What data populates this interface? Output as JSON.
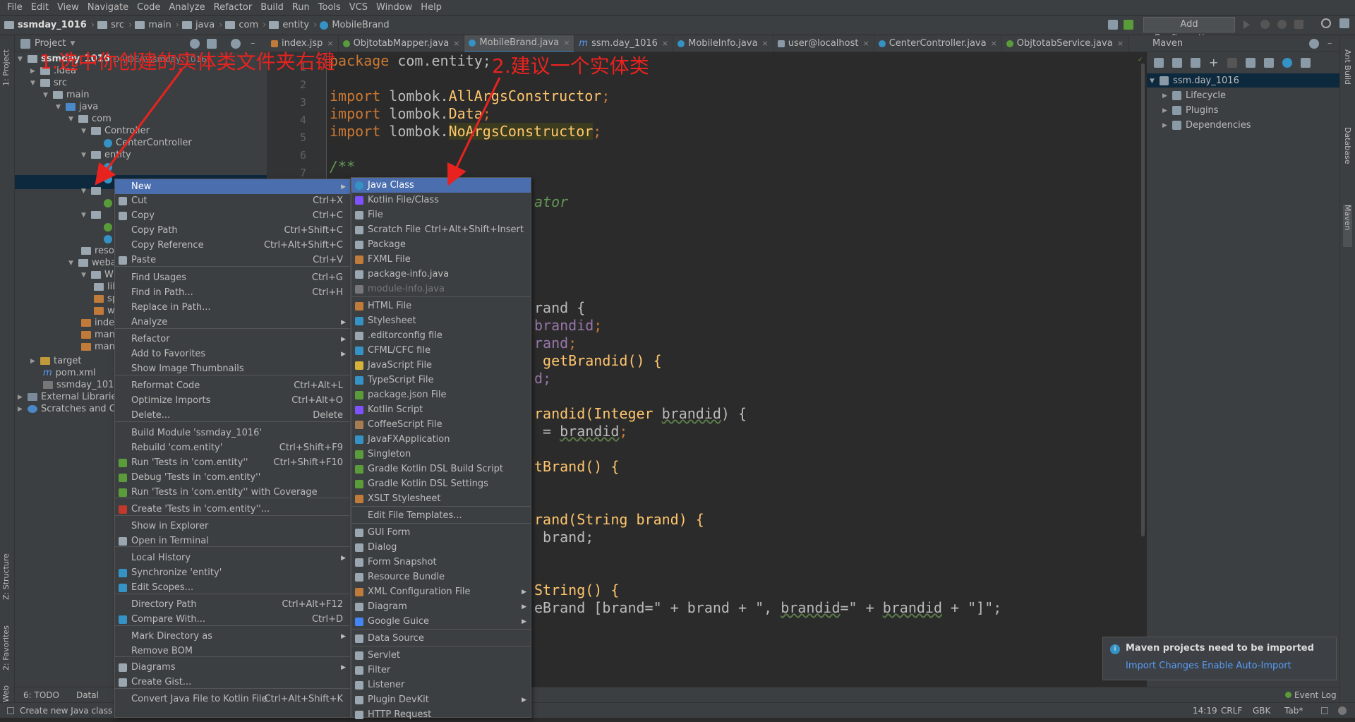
{
  "menubar": [
    "File",
    "Edit",
    "View",
    "Navigate",
    "Code",
    "Analyze",
    "Refactor",
    "Build",
    "Run",
    "Tools",
    "VCS",
    "Window",
    "Help"
  ],
  "breadcrumb": [
    "ssmday_1016",
    "src",
    "main",
    "java",
    "com",
    "entity",
    "MobileBrand"
  ],
  "toolbar": {
    "add_config": "Add Configuration..."
  },
  "left_tabs": [
    "1: Project",
    "Z: Structure",
    "2: Favorites",
    "Web"
  ],
  "right_tabs": [
    "Ant Build",
    "Database",
    "Maven"
  ],
  "project": {
    "header": "Project",
    "tree": [
      "ssmday_1016",
      "D:\\IDEA\\ssmday_1016",
      ".idea",
      "src",
      "main",
      "java",
      "com",
      "Controller",
      "CenterController",
      "entity",
      "resources",
      "webapp",
      "WEB-INF",
      "lib",
      "sp",
      "w",
      "index",
      "many",
      "many",
      "target",
      "pom.xml",
      "ssmday_1016.iml",
      "External Libraries",
      "Scratches and Co"
    ]
  },
  "tabs": [
    "index.jsp",
    "ObjtotabMapper.java",
    "MobileBrand.java",
    "ssm.day_1016",
    "MobileInfo.java",
    "user@localhost",
    "CenterController.java",
    "ObjtotabService.java"
  ],
  "line_numbers": [
    "1",
    "2",
    "3",
    "4",
    "5",
    "6",
    "7"
  ],
  "code": {
    "l1a": "package ",
    "l1b": "com.entity;",
    "l3a": "import ",
    "l3b": "lombok.",
    "l3c": "AllArgsConstructor",
    ";": ";",
    "l4b": "lombok.",
    "l4c": "Data",
    "l5b": "lombok.",
    "l5c": "NoArgsConstructor",
    "l7": "/**",
    "frag_author": "ator",
    "f1": "rand {",
    "f2a": "",
    "f2b": "brandid",
    "f3b": "rand",
    "f4": " getBrandid() {",
    "f5": "d;",
    "f6a": "randid(Integer ",
    "f6b": "brandid",
    ") {": ") {",
    "f7": " = ",
    "f7b": "brandid",
    "f8": "tBrand() {",
    "f9": "rand(String brand) {",
    "f10": " brand;",
    "f11": "String() {",
    "f12a": "eBrand [brand=\" + brand + \", ",
    "f12b": "brandid",
    "f12c": "=\" + ",
    "f12d": "brandid",
    "f12e": " + \"]\";"
  },
  "maven": {
    "title": "Maven",
    "root": "ssm.day_1016",
    "items": [
      "Lifecycle",
      "Plugins",
      "Dependencies"
    ]
  },
  "context_menu": [
    {
      "label": "New",
      "sub": true
    },
    {
      "label": "Cut",
      "sc": "Ctrl+X"
    },
    {
      "label": "Copy",
      "sc": "Ctrl+C"
    },
    {
      "label": "Copy Path",
      "sc": "Ctrl+Shift+C"
    },
    {
      "label": "Copy Reference",
      "sc": "Ctrl+Alt+Shift+C"
    },
    {
      "label": "Paste",
      "sc": "Ctrl+V"
    },
    {
      "label": "Find Usages",
      "sc": "Ctrl+G"
    },
    {
      "label": "Find in Path...",
      "sc": "Ctrl+H"
    },
    {
      "label": "Replace in Path...",
      "sc": ""
    },
    {
      "label": "Analyze",
      "sub": true
    },
    {
      "label": "Refactor",
      "sub": true
    },
    {
      "label": "Add to Favorites",
      "sub": true
    },
    {
      "label": "Show Image Thumbnails",
      "sc": ""
    },
    {
      "label": "Reformat Code",
      "sc": "Ctrl+Alt+L"
    },
    {
      "label": "Optimize Imports",
      "sc": "Ctrl+Alt+O"
    },
    {
      "label": "Delete...",
      "sc": "Delete"
    },
    {
      "label": "Build Module 'ssmday_1016'",
      "sc": ""
    },
    {
      "label": "Rebuild 'com.entity'",
      "sc": "Ctrl+Shift+F9"
    },
    {
      "label": "Run 'Tests in 'com.entity''",
      "sc": "Ctrl+Shift+F10"
    },
    {
      "label": "Debug 'Tests in 'com.entity''",
      "sc": ""
    },
    {
      "label": "Run 'Tests in 'com.entity'' with Coverage",
      "sc": ""
    },
    {
      "label": "Create 'Tests in 'com.entity''...",
      "sc": ""
    },
    {
      "label": "Show in Explorer",
      "sc": ""
    },
    {
      "label": "Open in Terminal",
      "sc": ""
    },
    {
      "label": "Local History",
      "sub": true
    },
    {
      "label": "Synchronize 'entity'",
      "sc": ""
    },
    {
      "label": "Edit Scopes...",
      "sc": ""
    },
    {
      "label": "Directory Path",
      "sc": "Ctrl+Alt+F12"
    },
    {
      "label": "Compare With...",
      "sc": "Ctrl+D"
    },
    {
      "label": "Mark Directory as",
      "sub": true
    },
    {
      "label": "Remove BOM",
      "sc": ""
    },
    {
      "label": "Diagrams",
      "sub": true
    },
    {
      "label": "Create Gist...",
      "sc": ""
    },
    {
      "label": "Convert Java File to Kotlin File",
      "sc": "Ctrl+Alt+Shift+K"
    }
  ],
  "new_submenu": [
    {
      "label": "Java Class"
    },
    {
      "label": "Kotlin File/Class"
    },
    {
      "label": "File"
    },
    {
      "label": "Scratch File",
      "sc": "Ctrl+Alt+Shift+Insert"
    },
    {
      "label": "Package"
    },
    {
      "label": "FXML File"
    },
    {
      "label": "package-info.java"
    },
    {
      "label": "module-info.java"
    },
    {
      "label": "HTML File"
    },
    {
      "label": "Stylesheet"
    },
    {
      "label": ".editorconfig file"
    },
    {
      "label": "CFML/CFC file"
    },
    {
      "label": "JavaScript File"
    },
    {
      "label": "TypeScript File"
    },
    {
      "label": "package.json File"
    },
    {
      "label": "Kotlin Script"
    },
    {
      "label": "CoffeeScript File"
    },
    {
      "label": "JavaFXApplication"
    },
    {
      "label": "Singleton"
    },
    {
      "label": "Gradle Kotlin DSL Build Script"
    },
    {
      "label": "Gradle Kotlin DSL Settings"
    },
    {
      "label": "XSLT Stylesheet"
    },
    {
      "label": "Edit File Templates..."
    },
    {
      "label": "GUI Form"
    },
    {
      "label": "Dialog"
    },
    {
      "label": "Form Snapshot"
    },
    {
      "label": "Resource Bundle"
    },
    {
      "label": "XML Configuration File"
    },
    {
      "label": "Diagram"
    },
    {
      "label": "Google Guice"
    },
    {
      "label": "Data Source"
    },
    {
      "label": "Servlet"
    },
    {
      "label": "Filter"
    },
    {
      "label": "Listener"
    },
    {
      "label": "Plugin DevKit"
    },
    {
      "label": "HTTP Request"
    }
  ],
  "annotations": {
    "a1": "1.选中你创建的实体类文件夹右键",
    "a2": "2.建议一个实体类"
  },
  "notification": {
    "title": "Maven projects need to be imported",
    "import": "Import Changes",
    "auto": "Enable Auto-Import"
  },
  "bottom": {
    "todo": "6: TODO",
    "data": "Datal",
    "event": "Event Log"
  },
  "status": {
    "hint": "Create new Java class",
    "pos": "14:19",
    "crlf": "CRLF",
    "enc": "GBK",
    "tab": "Tab*"
  },
  "colors": {
    "accent": "#4b6eaf",
    "annotation": "#e8231f"
  }
}
